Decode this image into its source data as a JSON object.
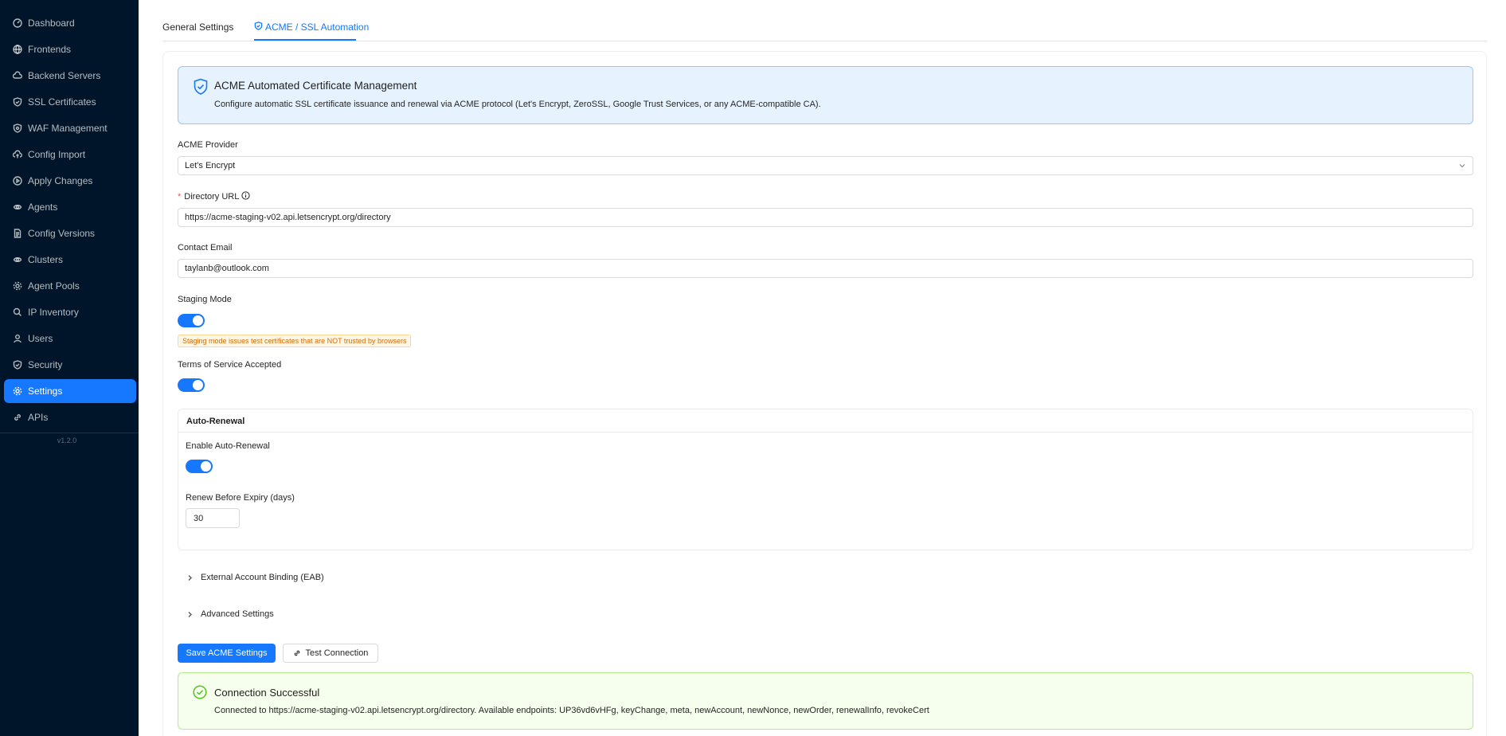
{
  "sidebar": {
    "items": [
      {
        "label": "Dashboard",
        "icon": "dashboard-icon"
      },
      {
        "label": "Frontends",
        "icon": "globe-icon"
      },
      {
        "label": "Backend Servers",
        "icon": "cloud-server-icon"
      },
      {
        "label": "SSL Certificates",
        "icon": "shield-check-icon"
      },
      {
        "label": "WAF Management",
        "icon": "shield-icon"
      },
      {
        "label": "Config Import",
        "icon": "cloud-upload-icon"
      },
      {
        "label": "Apply Changes",
        "icon": "play-circle-icon"
      },
      {
        "label": "Agents",
        "icon": "robot-icon"
      },
      {
        "label": "Config Versions",
        "icon": "file-text-icon"
      },
      {
        "label": "Clusters",
        "icon": "cluster-icon"
      },
      {
        "label": "Agent Pools",
        "icon": "gear-icon"
      },
      {
        "label": "IP Inventory",
        "icon": "search-icon"
      },
      {
        "label": "Users",
        "icon": "user-icon"
      },
      {
        "label": "Security",
        "icon": "security-shield-icon"
      },
      {
        "label": "Settings",
        "icon": "settings-gear-icon",
        "active": true
      },
      {
        "label": "APIs",
        "icon": "api-link-icon"
      }
    ],
    "version": "v1.2.0"
  },
  "tabs": [
    {
      "label": "General Settings"
    },
    {
      "label": "ACME / SSL Automation",
      "active": true
    }
  ],
  "info_alert": {
    "title": "ACME Automated Certificate Management",
    "description": "Configure automatic SSL certificate issuance and renewal via ACME protocol (Let's Encrypt, ZeroSSL, Google Trust Services, or any ACME-compatible CA)."
  },
  "form": {
    "provider_label": "ACME Provider",
    "provider_value": "Let's Encrypt",
    "directory_required_mark": "*",
    "directory_label": "Directory URL",
    "directory_value": "https://acme-staging-v02.api.letsencrypt.org/directory",
    "email_label": "Contact Email",
    "email_value": "taylanb@outlook.com",
    "staging_label": "Staging Mode",
    "staging_on": true,
    "staging_warning": "Staging mode issues test certificates that are NOT trusted by browsers",
    "tos_label": "Terms of Service Accepted",
    "tos_on": true
  },
  "auto_renewal": {
    "title": "Auto-Renewal",
    "enable_label": "Enable Auto-Renewal",
    "enable_on": true,
    "renew_label": "Renew Before Expiry (days)",
    "renew_value": "30"
  },
  "collapses": {
    "eab": "External Account Binding (EAB)",
    "advanced": "Advanced Settings"
  },
  "buttons": {
    "save": "Save ACME Settings",
    "test": "Test Connection"
  },
  "success_alert": {
    "title": "Connection Successful",
    "description": "Connected to https://acme-staging-v02.api.letsencrypt.org/directory. Available endpoints: UP36vd6vHFg, keyChange, meta, newAccount, newNonce, newOrder, renewalInfo, revokeCert"
  },
  "colors": {
    "sidebar_bg": "#001529",
    "primary": "#1677ff",
    "info_bg": "#e6f2fd",
    "success_bg": "#f6ffed",
    "warning_text": "#d46b08"
  }
}
